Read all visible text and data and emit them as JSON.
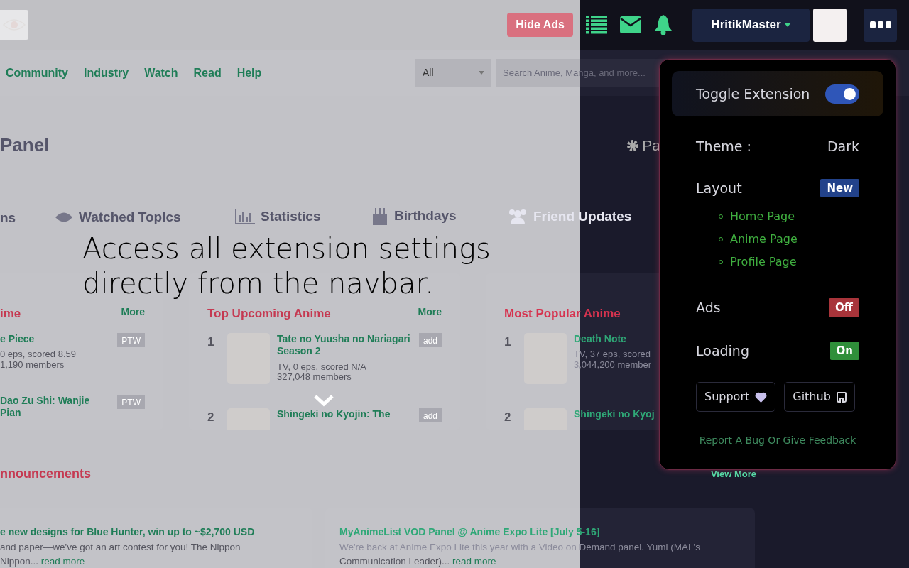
{
  "header": {
    "hide_ads_button": "Hide Ads",
    "username": "HritikMaster"
  },
  "nav": {
    "links": [
      "Community",
      "Industry",
      "Watch",
      "Read",
      "Help"
    ],
    "search_scope": "All",
    "search": {
      "placeholder": "Search Anime, Manga, and more..."
    }
  },
  "page": {
    "title": "Panel",
    "side_link": "Pa",
    "tabs": [
      "ns",
      "Watched Topics",
      "Statistics",
      "Birthdays",
      "Friend Updates"
    ]
  },
  "ranking_cards": [
    {
      "title": "ime",
      "more": "More",
      "entries": [
        {
          "title": "e Piece",
          "info": "0 eps, scored 8.59",
          "members": "1,190 members",
          "action": "PTW"
        },
        {
          "title": "Dao Zu Shi: Wanjie Pian",
          "action": "PTW"
        }
      ]
    },
    {
      "title": "Top Upcoming Anime",
      "more": "More",
      "entries": [
        {
          "rank": "1",
          "title": "Tate no Yuusha no Nariagari Season 2",
          "info": "TV, 0 eps, scored N/A",
          "members": "327,048 members",
          "action": "add"
        },
        {
          "rank": "2",
          "title": "Shingeki no Kyojin: The",
          "action": "add"
        }
      ]
    },
    {
      "title": "Most Popular Anime",
      "entries": [
        {
          "rank": "1",
          "title": "Death Note",
          "info": "TV, 37 eps, scored",
          "members": "3,044,200 member"
        },
        {
          "rank": "2",
          "title": "Shingeki no Kyoj"
        }
      ]
    }
  ],
  "announcements": {
    "title": "nnouncements",
    "view_more": "View More",
    "items": [
      {
        "title": "e new designs for Blue Hunter, win up to ~$2,700 USD",
        "lines": [
          "and paper—we've got an art contest for you! The Nippon",
          "Nippon..."
        ],
        "read_more": "read more"
      },
      {
        "title": "MyAnimeList VOD Panel @ Anime Expo Lite [July 5-16]",
        "lines": [
          "We're back at Anime Expo Lite this year with a Video on Demand panel. Yumi (MAL's",
          "Communication Leader)..."
        ],
        "read_more": "read more"
      }
    ]
  },
  "caption": "Access all extension settings directly from the navbar.",
  "extension_popup": {
    "toggle": {
      "label": "Toggle Extension",
      "on": true
    },
    "theme": {
      "label": "Theme :",
      "value": "Dark"
    },
    "layout": {
      "label": "Layout",
      "badge": "New",
      "pages": [
        "Home Page",
        "Anime Page",
        "Profile Page"
      ]
    },
    "settings": [
      {
        "label": "Ads",
        "on": false,
        "state_text": "Off"
      },
      {
        "label": "Loading",
        "on": true,
        "state_text": "On"
      }
    ],
    "buttons": [
      "Support",
      "Github"
    ],
    "feedback_link": "Report A Bug Or Give Feedback"
  }
}
